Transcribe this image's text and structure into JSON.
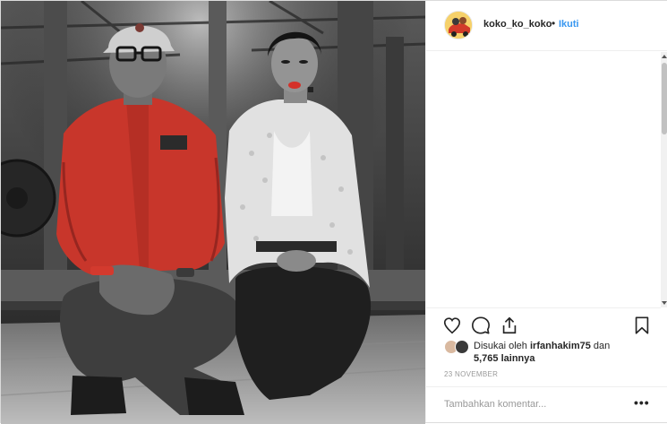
{
  "post": {
    "username": "koko_ko_koko",
    "separator": "•",
    "follow_label": "Ikuti"
  },
  "actions": {
    "like_icon": "heart-icon",
    "comment_icon": "comment-icon",
    "share_icon": "share-icon",
    "save_icon": "bookmark-icon"
  },
  "likes": {
    "prefix": "Disukai oleh",
    "liker": "irfanhakim75",
    "connector": "dan",
    "others": "5,765 lainnya"
  },
  "date": "23 NOVEMBER",
  "comment": {
    "placeholder": "Tambahkan komentar...",
    "more_label": "•••"
  },
  "colors": {
    "accent": "#3897f0",
    "shirt_red": "#c8362b",
    "border": "#efefef"
  }
}
